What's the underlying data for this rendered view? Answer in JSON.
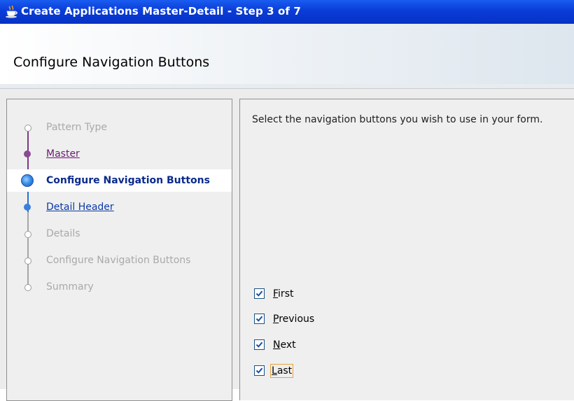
{
  "window": {
    "title": "Create Applications Master-Detail - Step 3 of 7",
    "icon": "java-cup-icon"
  },
  "header": {
    "page_title": "Configure Navigation Buttons"
  },
  "train": {
    "steps": [
      {
        "label": "Pattern Type",
        "state": "disabled"
      },
      {
        "label": "Master",
        "state": "visited"
      },
      {
        "label": "Configure Navigation Buttons",
        "state": "current"
      },
      {
        "label": "Detail Header",
        "state": "enabled"
      },
      {
        "label": "Details",
        "state": "disabled"
      },
      {
        "label": "Configure Navigation Buttons",
        "state": "disabled"
      },
      {
        "label": "Summary",
        "state": "disabled"
      }
    ]
  },
  "main": {
    "instructions": "Select the navigation buttons you wish to use in your form.",
    "buttons": [
      {
        "mnemonic": "F",
        "rest": "irst",
        "checked": true
      },
      {
        "mnemonic": "P",
        "rest": "revious",
        "checked": true
      },
      {
        "mnemonic": "N",
        "rest": "ext",
        "checked": true
      },
      {
        "mnemonic": "L",
        "rest": "ast",
        "checked": true,
        "focused": true
      }
    ]
  },
  "colors": {
    "titlebar": "#0a3cd8",
    "current_step": "#0a2a8c",
    "visited_step": "#6b1a73",
    "enabled_step": "#0b3aa8",
    "disabled_step": "#a9a9a9",
    "focus_ring": "#e8a33a"
  }
}
